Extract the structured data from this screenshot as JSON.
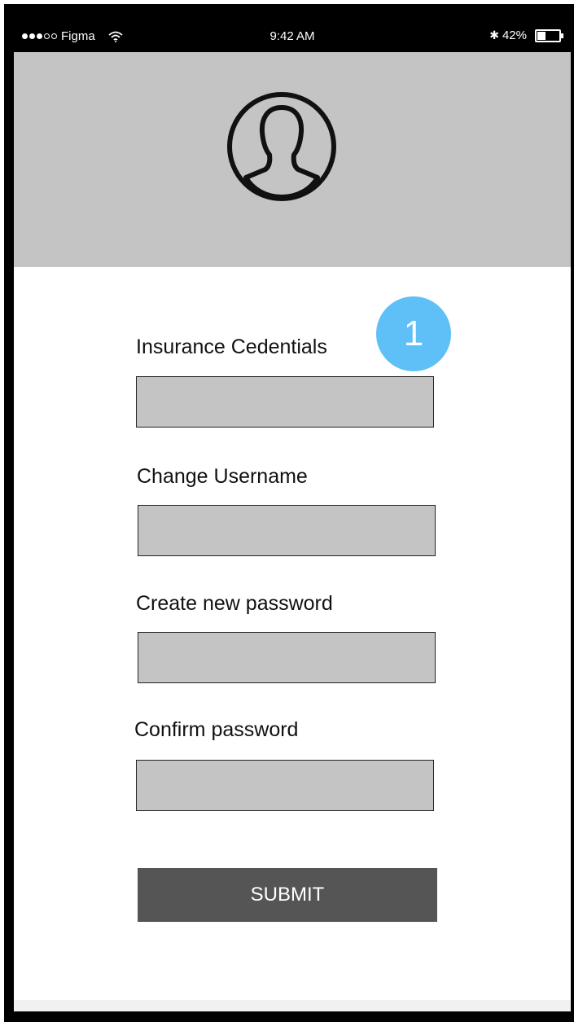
{
  "status_bar": {
    "carrier": "Figma",
    "time": "9:42 AM",
    "bluetooth": "✱",
    "battery": "42%",
    "battery_level": 0.42
  },
  "badge": {
    "label": "1",
    "color": "#5fc0f7"
  },
  "form": {
    "insurance_label": "Insurance Cedentials",
    "username_label": "Change Username",
    "password_label": "Create new password",
    "confirm_label": "Confirm password",
    "submit_label": "SUBMIT"
  },
  "icons": {
    "avatar": "user-avatar-icon",
    "wifi": "wifi-icon",
    "battery": "battery-icon"
  },
  "colors": {
    "header_bg": "#c4c4c4",
    "input_bg": "#c4c4c4",
    "button_bg": "#555555"
  }
}
